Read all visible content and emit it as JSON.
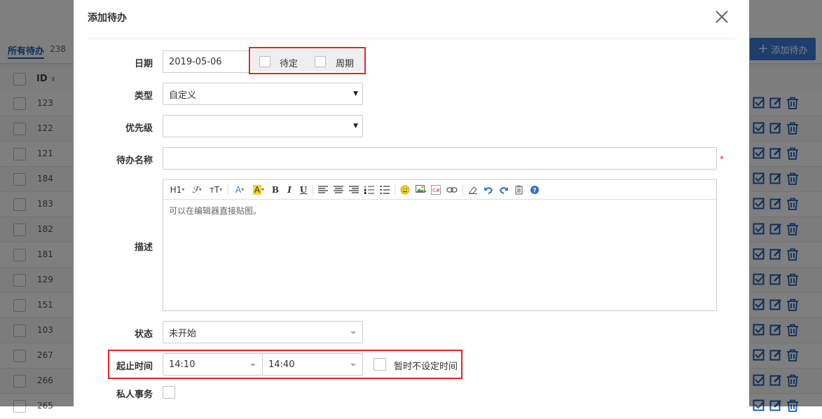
{
  "background": {
    "tab_label": "所有待办",
    "tab_count": "238",
    "add_button_label": "添加待办",
    "id_header": "ID",
    "row_ids": [
      "123",
      "122",
      "121",
      "184",
      "183",
      "182",
      "181",
      "129",
      "151",
      "103",
      "267",
      "266",
      "265"
    ]
  },
  "modal": {
    "title": "添加待办",
    "date_label": "日期",
    "date_value": "2019-05-06",
    "pending_label": "待定",
    "recurring_label": "周期",
    "type_label": "类型",
    "type_value": "自定义",
    "priority_label": "优先级",
    "priority_value": "",
    "name_label": "待办名称",
    "name_value": "",
    "required_mark": "*",
    "desc_label": "描述",
    "desc_placeholder": "可以在编辑器直接贴图。",
    "status_label": "状态",
    "status_value": "未开始",
    "time_label": "起止时间",
    "time_start": "14:10",
    "time_end": "14:40",
    "no_time_label": "暂时不设定时间",
    "private_label": "私人事务"
  },
  "toolbar": {
    "heading": "H1",
    "font": "ℱ",
    "size": "тT",
    "font_color": "A",
    "bg_color": "A",
    "bold": "B",
    "italic": "I",
    "underline": "U"
  },
  "colors": {
    "accent": "#3b7ddd",
    "highlight_red": "#e5222a",
    "action_icon": "#1a5fb4"
  }
}
